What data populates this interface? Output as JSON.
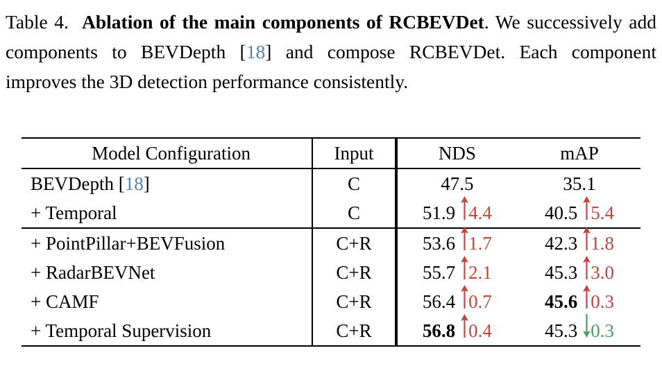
{
  "caption": {
    "label": "Table 4.",
    "bold_title": "Ablation of the main components of RCBEVDet",
    "period": ".",
    "body_before_cite": " We successively add components to BEVDepth [",
    "cite": "18",
    "body_after_cite": "] and compose RCBEVDet. Each component improves the 3D detection performance consistently."
  },
  "table": {
    "headers": {
      "model": "Model Configuration",
      "input": "Input",
      "nds": "NDS",
      "map": "mAP"
    },
    "rows": [
      {
        "model": "BEVDepth [18]",
        "model_plain": "BEVDepth ",
        "model_cite_open": "[",
        "model_cite": "18",
        "model_cite_close": "]",
        "input": "C",
        "nds": "47.5",
        "nds_bold": false,
        "nds_delta": "",
        "nds_dir": "",
        "map": "35.1",
        "map_bold": false,
        "map_delta": "",
        "map_dir": ""
      },
      {
        "model": "+ Temporal",
        "input": "C",
        "nds": "51.9",
        "nds_bold": false,
        "nds_delta": "4.4",
        "nds_dir": "up",
        "map": "40.5",
        "map_bold": false,
        "map_delta": "5.4",
        "map_dir": "up"
      },
      {
        "model": "+ PointPillar+BEVFusion",
        "input": "C+R",
        "nds": "53.6",
        "nds_bold": false,
        "nds_delta": "1.7",
        "nds_dir": "up",
        "map": "42.3",
        "map_bold": false,
        "map_delta": "1.8",
        "map_dir": "up"
      },
      {
        "model": "+ RadarBEVNet",
        "input": "C+R",
        "nds": "55.7",
        "nds_bold": false,
        "nds_delta": "2.1",
        "nds_dir": "up",
        "map": "45.3",
        "map_bold": false,
        "map_delta": "3.0",
        "map_dir": "up"
      },
      {
        "model": "+ CAMF",
        "input": "C+R",
        "nds": "56.4",
        "nds_bold": false,
        "nds_delta": "0.7",
        "nds_dir": "up",
        "map": "45.6",
        "map_bold": true,
        "map_delta": "0.3",
        "map_dir": "up"
      },
      {
        "model": "+ Temporal Supervision",
        "input": "C+R",
        "nds": "56.8",
        "nds_bold": true,
        "nds_delta": "0.4",
        "nds_dir": "up",
        "map": "45.3",
        "map_bold": false,
        "map_delta": "0.3",
        "map_dir": "down"
      }
    ],
    "group_break_after_row_index": 1
  },
  "colors": {
    "increase": "#c0453a",
    "decrease": "#49a05b",
    "citation": "#5381b3",
    "text": "#000000",
    "rule": "#000000",
    "background": "#ffffff"
  },
  "icons": {
    "up_arrow": "arrow-up-icon",
    "down_arrow": "arrow-down-icon"
  }
}
